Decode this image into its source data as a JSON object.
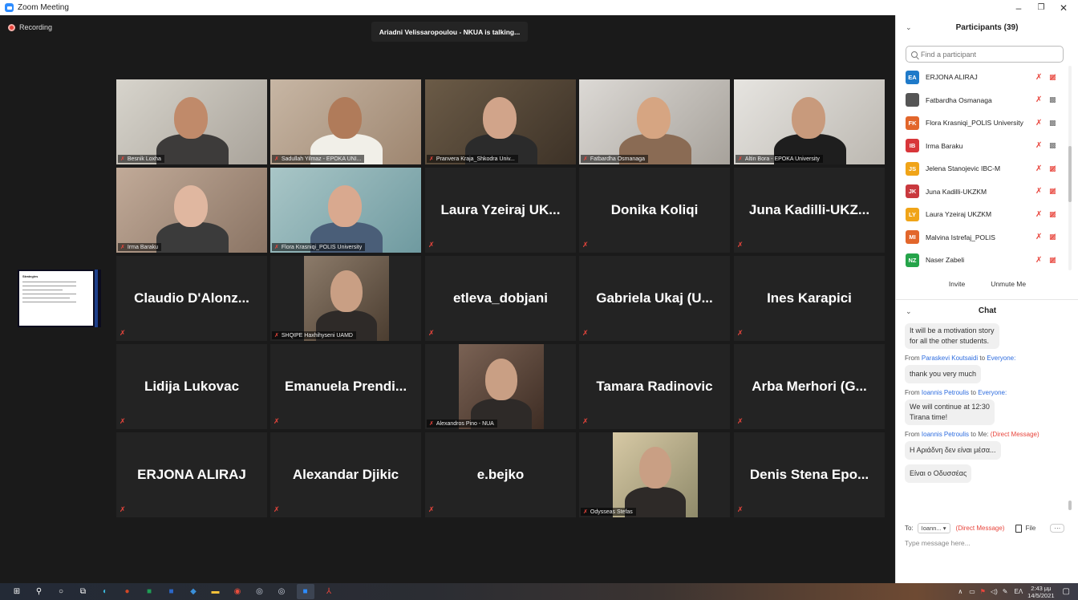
{
  "window": {
    "title": "Zoom Meeting",
    "minimize": "–",
    "restore": "❐",
    "close": "✕"
  },
  "recording_label": "Recording",
  "talking_banner": "Ariadni Velissaropoulou - NKUA is talking...",
  "tiles": [
    {
      "kind": "video",
      "caption": "Besnik Loxha"
    },
    {
      "kind": "video",
      "caption": "Sadullah Yilmaz - EPOKA UNI..."
    },
    {
      "kind": "video",
      "caption": "Pranvera Kraja_Shkodra Univ..."
    },
    {
      "kind": "video",
      "caption": "Fatbardha Osmanaga"
    },
    {
      "kind": "video",
      "caption": "Altin Bora - EPOKA University"
    },
    {
      "kind": "video",
      "caption": "Irma Baraku"
    },
    {
      "kind": "video",
      "caption": "Flora Krasniqi_POLIS University"
    },
    {
      "kind": "name",
      "label": "Laura Yzeiraj UK..."
    },
    {
      "kind": "name",
      "label": "Donika Koliqi"
    },
    {
      "kind": "name",
      "label": "Juna Kadilli-UKZ..."
    },
    {
      "kind": "name",
      "label": "Claudio D'Alonz..."
    },
    {
      "kind": "photo",
      "caption": "SHQIPE Haxhihyseni UAMD"
    },
    {
      "kind": "name",
      "label": "etleva_dobjani"
    },
    {
      "kind": "name",
      "label": "Gabriela Ukaj (U..."
    },
    {
      "kind": "name",
      "label": "Ines Karapici"
    },
    {
      "kind": "name",
      "label": "Lidija Lukovac"
    },
    {
      "kind": "name",
      "label": "Emanuela Prendi..."
    },
    {
      "kind": "photo",
      "caption": "Alexandros Pino - NUA"
    },
    {
      "kind": "name",
      "label": "Tamara Radinovic"
    },
    {
      "kind": "name",
      "label": "Arba Merhori (G..."
    },
    {
      "kind": "name",
      "label": "ERJONA ALIRAJ"
    },
    {
      "kind": "name",
      "label": "Alexandar Djikic"
    },
    {
      "kind": "name",
      "label": "e.bejko"
    },
    {
      "kind": "photo",
      "caption": "Odysseas Stefas"
    },
    {
      "kind": "name",
      "label": "Denis Stena Epo..."
    }
  ],
  "share_thumb": {
    "heading": "Strategies"
  },
  "participants": {
    "header": "Participants (39)",
    "search_placeholder": "Find a participant",
    "list": [
      {
        "initials": "EA",
        "color": "#1f7ac9",
        "name": "ERJONA ALIRAJ",
        "video": "off"
      },
      {
        "initials": "",
        "color": "#555555",
        "name": "Fatbardha Osmanaga",
        "video": "on"
      },
      {
        "initials": "FK",
        "color": "#e2662b",
        "name": "Flora Krasniqi_POLIS University",
        "video": "on"
      },
      {
        "initials": "IB",
        "color": "#d8363a",
        "name": "Irma Baraku",
        "video": "on"
      },
      {
        "initials": "JS",
        "color": "#f0a418",
        "name": "Jelena Stanojevic IBC-M",
        "video": "off"
      },
      {
        "initials": "JK",
        "color": "#c9393e",
        "name": "Juna Kadilli-UKZKM",
        "video": "off"
      },
      {
        "initials": "LY",
        "color": "#f0a418",
        "name": "Laura Yzeiraj UKZKM",
        "video": "off"
      },
      {
        "initials": "MI",
        "color": "#e2662b",
        "name": "Malvina Istrefaj_POLIS",
        "video": "off"
      },
      {
        "initials": "NZ",
        "color": "#25a44a",
        "name": "Naser Zabeli",
        "video": "off"
      }
    ],
    "invite_label": "Invite",
    "unmute_label": "Unmute Me"
  },
  "chat": {
    "header": "Chat",
    "messages": [
      {
        "text1": "It will be a motivation story",
        "text2": "for all the other students."
      },
      {
        "from_prefix": "From",
        "from": "Paraskevi Koutsaidi",
        "to_word": "to",
        "to": "Everyone:",
        "text1": "thank you very much"
      },
      {
        "from_prefix": "From",
        "from": "Ioannis Petroulis",
        "to_word": "to",
        "to": "Everyone:",
        "text1": "We will continue at 12:30",
        "text2": "Tirana time!"
      },
      {
        "from_prefix": "From",
        "from": "Ioannis Petroulis",
        "to_word": "to Me:",
        "dm": "(Direct Message)",
        "text1": "Η Αριάδνη δεν είναι μέσα...",
        "text2": "Είναι ο Οδυσσέας"
      }
    ],
    "to_label": "To:",
    "to_value": "Ioann... ▾",
    "dm_label": "(Direct Message)",
    "file_label": "File",
    "more_label": "···",
    "input_placeholder": "Type message here..."
  },
  "taskbar": {
    "icons": [
      "windows-icon",
      "search-icon",
      "cortana-icon",
      "task-view-icon",
      "edge-icon",
      "powerpoint-icon",
      "excel-icon",
      "word-icon",
      "explorer-blue-icon",
      "file-explorer-icon",
      "chrome-icon",
      "zoom-alt-icon",
      "zoom-alt2-icon",
      "zoom-icon",
      "acrobat-icon"
    ],
    "lang": "EΛ",
    "time": "2:43 μμ",
    "date": "14/5/2021"
  },
  "colors": {
    "mute_red": "#e8453c",
    "link_blue": "#2d6cdf",
    "zoom_blue": "#2d8cff"
  }
}
